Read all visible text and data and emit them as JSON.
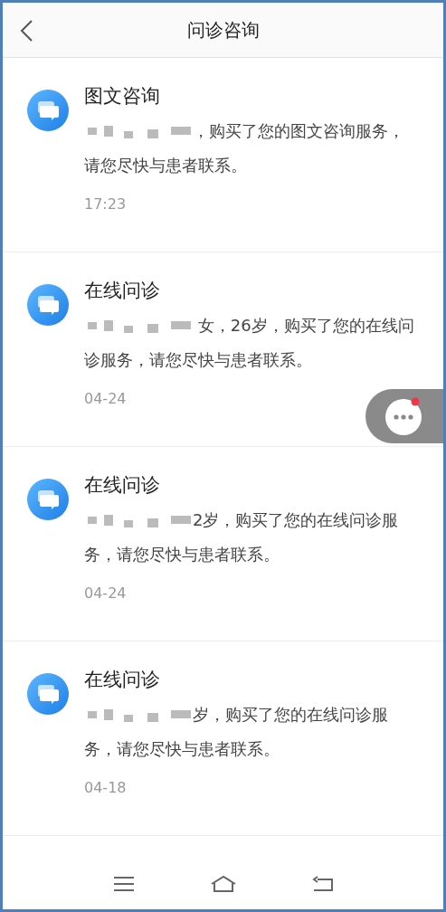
{
  "header": {
    "title": "问诊咨询"
  },
  "messages": [
    {
      "title": "图文咨询",
      "redacted": true,
      "message": "，购买了您的图文咨询服务，请您尽快与患者联系。",
      "time": "17:23"
    },
    {
      "title": "在线问诊",
      "redacted": true,
      "message": " 女，26岁，购买了您的在线问诊服务，请您尽快与患者联系。",
      "time": "04-24"
    },
    {
      "title": "在线问诊",
      "redacted": true,
      "message": "2岁，购买了您的在线问诊服务，请您尽快与患者联系。",
      "time": "04-24"
    },
    {
      "title": "在线问诊",
      "redacted": true,
      "message": "岁，购买了您的在线问诊服务，请您尽快与患者联系。",
      "time": "04-18"
    }
  ],
  "floating_chat": {
    "unread": true
  }
}
